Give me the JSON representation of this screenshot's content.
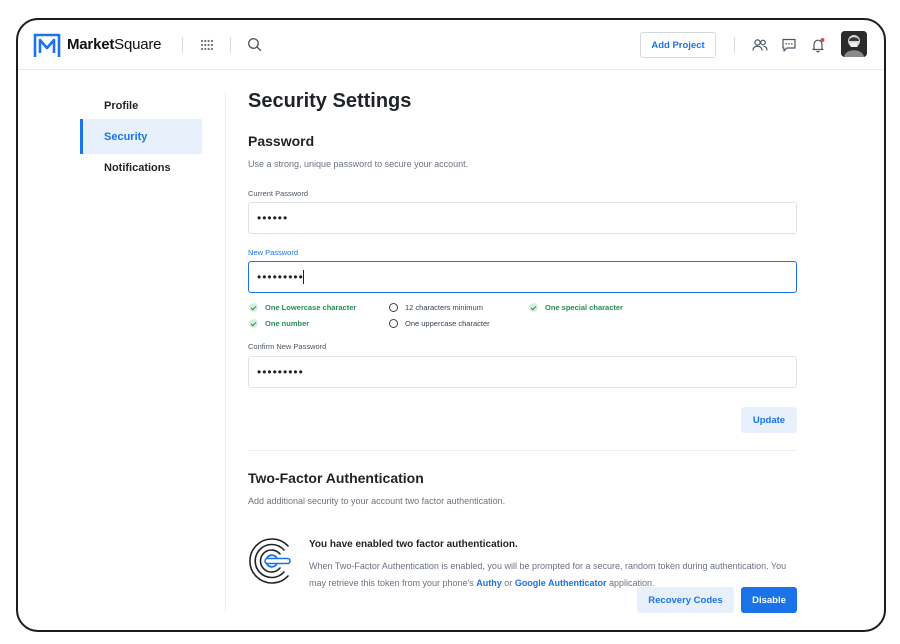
{
  "header": {
    "brand_bold": "Market",
    "brand_light": "Square",
    "add_project_label": "Add Project"
  },
  "sidebar": {
    "items": [
      {
        "label": "Profile"
      },
      {
        "label": "Security"
      },
      {
        "label": "Notifications"
      }
    ]
  },
  "page": {
    "title": "Security Settings"
  },
  "password": {
    "title": "Password",
    "description": "Use a strong, unique password to secure your account.",
    "current_label": "Current Password",
    "current_value": "••••••",
    "new_label": "New Password",
    "new_value": "•••••••••",
    "confirm_label": "Confirm New Password",
    "confirm_value": "•••••••••",
    "requirements": [
      {
        "label": "One Lowercase character",
        "met": true
      },
      {
        "label": "12 characters minimum",
        "met": false
      },
      {
        "label": "One special character",
        "met": true
      },
      {
        "label": "One number",
        "met": true
      },
      {
        "label": "One uppercase character",
        "met": false
      }
    ],
    "update_label": "Update"
  },
  "two_factor": {
    "title": "Two-Factor Authentication",
    "description": "Add additional security to your account two factor authentication.",
    "status_title": "You have enabled two factor authentication.",
    "text_part1": "When Two-Factor Authentication is enabled, you will be prompted for a secure, random token during authentication. You may retrieve this token from your phone's ",
    "link_authy": "Authy",
    "text_or": " or ",
    "link_google": "Google Authenticator",
    "text_end": " application.",
    "recovery_label": "Recovery Codes",
    "disable_label": "Disable"
  },
  "colors": {
    "accent": "#1a73e8",
    "success": "#23904d",
    "active_bg": "#e8f1fb"
  },
  "icons": [
    "app-logo",
    "apps-grid-icon",
    "search-icon",
    "users-icon",
    "chat-icon",
    "bell-icon",
    "avatar",
    "fingerprint-icon",
    "check-icon"
  ]
}
